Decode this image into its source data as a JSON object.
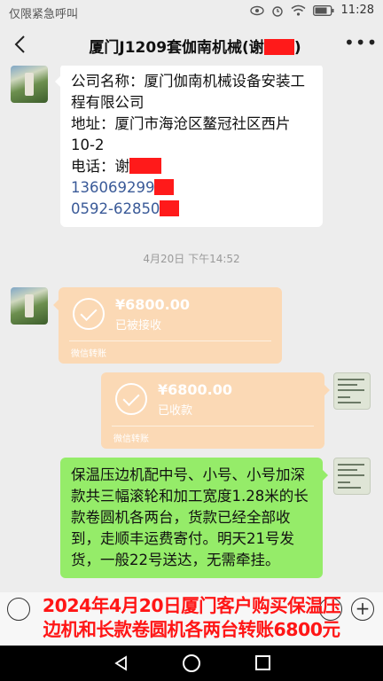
{
  "status_bar": {
    "carrier_text": "仅限紧急呼叫",
    "time": "11:28",
    "icons": [
      "eye-icon",
      "alarm-icon",
      "wifi-icon",
      "battery-icon"
    ]
  },
  "header": {
    "title": "厦门J1209套伽南机械(谢",
    "title_suffix": ")",
    "back_icon": "chevron-left-icon",
    "more_icon": "more-dots-icon"
  },
  "messages": {
    "contact_card": {
      "company_line": "公司名称：厦门伽南机械设备安装工程有限公司",
      "address_line": "地址：厦门市海沧区鳌冠社区西片10-2",
      "phone_label": "电话：谢",
      "mobile": "136069299",
      "landline": "0592-62850"
    },
    "timestamp": "4月20日 下午14:52",
    "transfer_received": {
      "amount": "¥6800.00",
      "status": "已被接收",
      "source": "微信转账"
    },
    "transfer_confirm": {
      "amount": "¥6800.00",
      "status": "已收款",
      "source": "微信转账"
    },
    "order_note": "保温压边机配中号、小号、小号加深款共三幅滚轮和加工宽度1.28米的长款卷圆机各两台，货款已经全部收到，走顺丰运费寄付。明天21号发货，一般22号送达，无需牵挂。"
  },
  "caption": {
    "line1": "2024年4月20日厦门客户购买保温压",
    "line2": "边机和长款卷圆机各两台转账6800元"
  },
  "colors": {
    "accent_red": "#ff1616",
    "transfer_orange": "#fbd9b5",
    "my_bubble_green": "#95ec69",
    "background": "#ededed"
  }
}
